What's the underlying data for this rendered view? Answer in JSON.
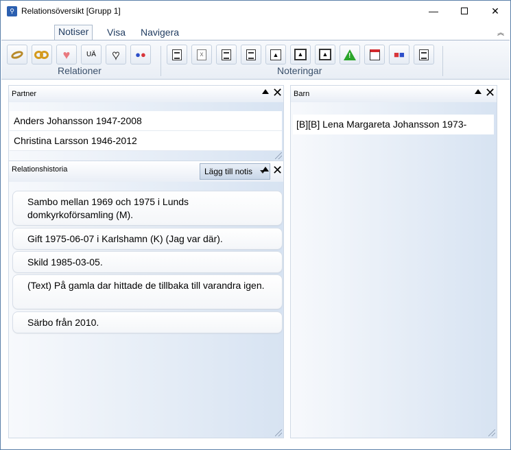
{
  "window": {
    "title": "Relationsöversikt [Grupp 1]",
    "app_icon": "family-tree-icon",
    "minimize": "—",
    "maximize": "",
    "close": "✕"
  },
  "ribbon": {
    "tabs": [
      {
        "label": "Notiser",
        "active": true
      },
      {
        "label": "Visa",
        "active": false
      },
      {
        "label": "Navigera",
        "active": false
      }
    ],
    "collapse_icon": "chevron-up-icon",
    "groups": {
      "relationer": {
        "label": "Relationer",
        "buttons": [
          {
            "icon": "single-ring-icon"
          },
          {
            "icon": "double-rings-icon"
          },
          {
            "icon": "smiling-heart-icon"
          },
          {
            "icon": "text-ua-icon",
            "text": "UÄ"
          },
          {
            "icon": "broken-heart-icon"
          },
          {
            "icon": "couple-icon"
          }
        ]
      },
      "noteringar": {
        "label": "Noteringar",
        "buttons": [
          {
            "icon": "document-text-icon"
          },
          {
            "icon": "document-x-icon"
          },
          {
            "icon": "document-list-icon"
          },
          {
            "icon": "document-lines-icon"
          },
          {
            "icon": "document-image-icon"
          },
          {
            "icon": "image-frame-icon"
          },
          {
            "icon": "image-caption-icon"
          },
          {
            "icon": "warning-icon"
          },
          {
            "icon": "note-pin-icon"
          },
          {
            "icon": "group-note-icon"
          },
          {
            "icon": "document-header-icon"
          }
        ]
      }
    }
  },
  "partner_panel": {
    "title": "Partner",
    "rows": [
      "Anders  Johansson  1947-2008",
      "Christina  Larsson  1946-2012"
    ]
  },
  "history_panel": {
    "title": "Relationshistoria",
    "add_note_label": "Lägg till notis",
    "notes": [
      "Sambo mellan 1969 och 1975 i Lunds domkyrkoförsamling (M).",
      "Gift 1975-06-07 i Karlshamn (K) (Jag var där).",
      "Skild 1985-03-05.",
      "(Text) På gamla dar hittade de tillbaka till varandra igen.",
      "Särbo från 2010."
    ]
  },
  "children_panel": {
    "title": "Barn",
    "rows": [
      "[B][B] Lena Margareta Johansson 1973-"
    ]
  },
  "colors": {
    "accent": "#2b5fb0",
    "panel_gradient_end": "#d7e3f2",
    "tab_text": "#1e3a5f"
  }
}
